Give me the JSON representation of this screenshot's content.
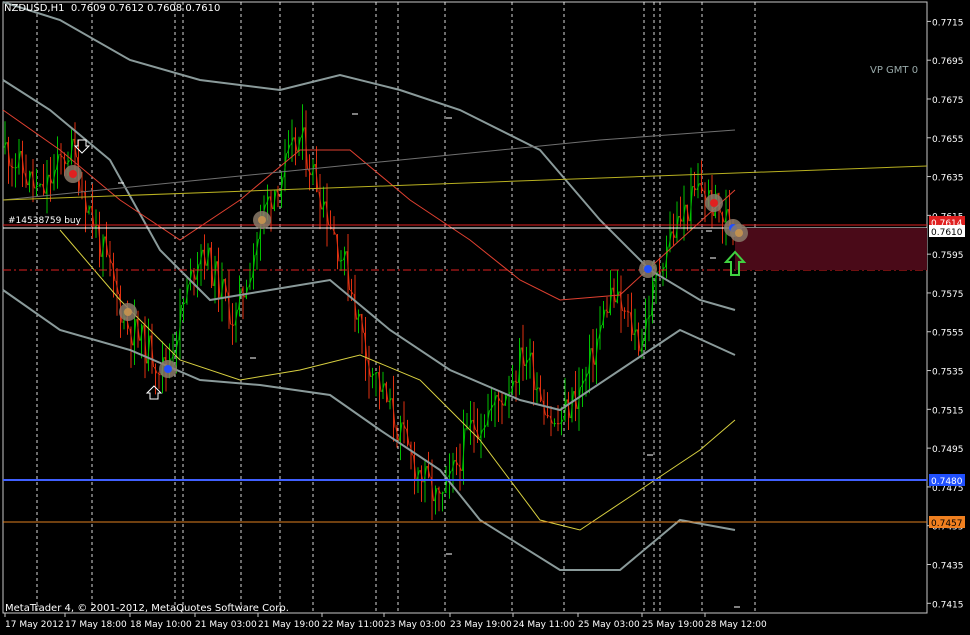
{
  "header": {
    "symbol": "NZDUSD,H1",
    "ohlc": "0.7609 0.7612 0.7608 0.7610"
  },
  "indicator_label": "VP GMT 0",
  "copyright": "MetaTrader 4, © 2001-2012, MetaQuotes Software Corp.",
  "order_label": "#14538759 buy",
  "colors": {
    "background": "#000000",
    "grid": "#ffffff",
    "bull": "#00c000",
    "bear": "#e03010",
    "band": "#8a9a9a",
    "trendline": "#b8b020",
    "blue_line": "#4060ff",
    "orange_line": "#e08020",
    "zone": "#4a0a18"
  },
  "chart_data": {
    "type": "candlestick",
    "ylim": [
      0.741,
      0.7725
    ],
    "price_ticks": [
      "0.7715",
      "0.7695",
      "0.7675",
      "0.7655",
      "0.7635",
      "0.7615",
      "0.7595",
      "0.7575",
      "0.7555",
      "0.7535",
      "0.7515",
      "0.7495",
      "0.7475",
      "0.7455",
      "0.7435",
      "0.7415"
    ],
    "time_labels": [
      "17 May 2012",
      "17 May 18:00",
      "18 May 10:00",
      "21 May 03:00",
      "21 May 19:00",
      "22 May 11:00",
      "23 May 03:00",
      "23 May 19:00",
      "24 May 11:00",
      "25 May 03:00",
      "25 May 19:00",
      "28 May 12:00"
    ],
    "current_price": "0.7610",
    "tp_price": "0.7614",
    "blue_level": "0.7480",
    "orange_level": "0.7457"
  }
}
